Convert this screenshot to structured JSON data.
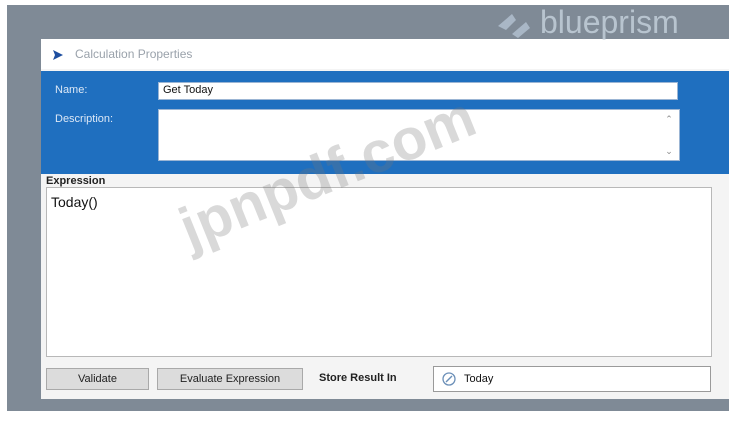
{
  "dialog": {
    "title": "Calculation Properties"
  },
  "header": {
    "name_label": "Name:",
    "name_value": "Get Today",
    "description_label": "Description:",
    "description_value": ""
  },
  "expression": {
    "label": "Expression",
    "value": "Today()"
  },
  "footer": {
    "validate_label": "Validate",
    "evaluate_label": "Evaluate Expression",
    "store_label": "Store Result In",
    "store_value": "Today"
  },
  "branding": {
    "logo_text": "blueprism",
    "watermark": "jpnpdf.com"
  },
  "colors": {
    "header_blue": "#1f6fbf",
    "frame_gray": "#7f8a96",
    "dialog_bg": "#f4f4f4"
  }
}
